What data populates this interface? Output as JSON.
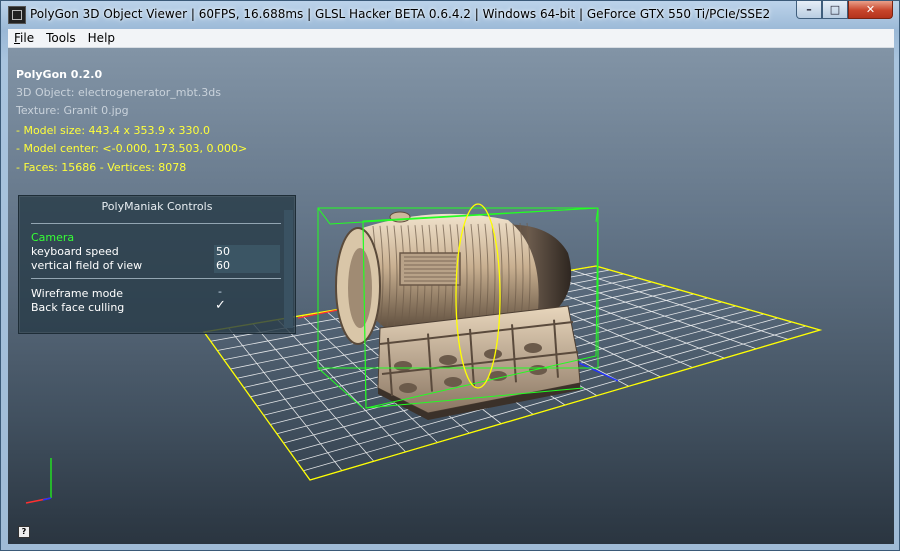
{
  "window": {
    "title": "PolyGon 3D Object Viewer | 60FPS, 16.688ms | GLSL Hacker BETA 0.6.4.2 | Windows 64-bit | GeForce GTX 550 Ti/PCIe/SSE2",
    "buttons": {
      "minimize": "–",
      "maximize": "□",
      "close": "✕"
    }
  },
  "menu": [
    {
      "underline": "F",
      "rest": "ile"
    },
    {
      "underline": "",
      "rest": "Tools"
    },
    {
      "underline": "",
      "rest": "Help"
    }
  ],
  "info": {
    "app_version": "PolyGon 0.2.0",
    "object": "3D Object: electrogenerator_mbt.3ds",
    "texture": "Texture: Granit 0.jpg",
    "model_size": "- Model size:  443.4 x 353.9 x 330.0",
    "model_center": "- Model center:  <-0.000, 173.503, 0.000>",
    "faces_vertices": "- Faces: 15686 - Vertices: 8078"
  },
  "controls": {
    "title": "PolyManiak Controls",
    "section_camera": "Camera",
    "keyboard_speed_label": "keyboard speed",
    "keyboard_speed_value": "50",
    "fov_label": "vertical field of view",
    "fov_value": "60",
    "wireframe_label": "Wireframe mode",
    "wireframe_value": "-",
    "backface_label": "Back face culling",
    "backface_value": "✓"
  },
  "help_icon": "?",
  "colors": {
    "grid": "#ffffff",
    "grid_border": "#ffff00",
    "bbox": "#22ff22",
    "axis_x": "#ff3030",
    "axis_y": "#22dd22",
    "axis_z": "#2233ff",
    "info_yellow": "#ffff3a",
    "camera_green": "#35ff35"
  }
}
